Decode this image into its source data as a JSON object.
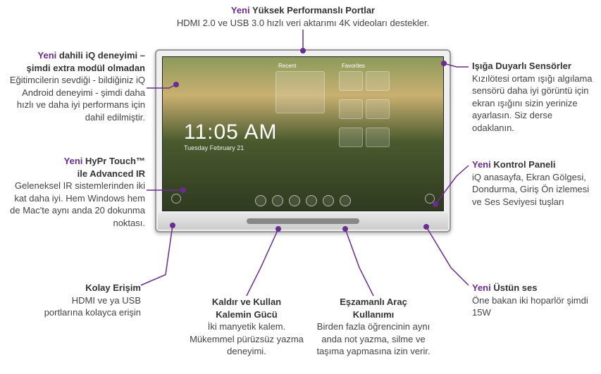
{
  "top": {
    "new": "Yeni",
    "title": " Yüksek Performanslı Portlar",
    "desc": "HDMI 2.0 ve USB 3.0 hızlı veri aktarımı 4K videoları destekler."
  },
  "left1": {
    "new": "Yeni",
    "title_a": " dahili iQ deneyimi –",
    "title_b": "şimdi extra modül olmadan",
    "desc": "Eğitimcilerin sevdiği - bildiğiniz iQ Android deneyimi  - şimdi daha hızlı ve daha iyi performans için dahil edilmiştir."
  },
  "left2": {
    "new": "Yeni",
    "title_a": " HyPr Touch™",
    "title_b": "ile Advanced IR",
    "desc": "Geleneksel IR sistemlerinden iki kat daha iyi. Hem Windows hem de Mac'te aynı anda 20 dokunma noktası."
  },
  "left3": {
    "title": "Kolay Erişim",
    "desc": "HDMI ve ya USB portlarına kolayca erişin"
  },
  "bottom1": {
    "title_a": "Kaldır ve Kullan",
    "title_b": "Kalemin Gücü",
    "desc": "İki manyetik kalem. Mükemmel pürüzsüz yazma deneyimi."
  },
  "bottom2": {
    "title_a": "Eşzamanlı Araç",
    "title_b": "Kullanımı",
    "desc": "Birden fazla öğrencinin aynı anda not yazma, silme ve taşıma yapmasına izin verir."
  },
  "right1": {
    "title": "Işığa Duyarlı Sensörler",
    "desc": "Kızılötesi ortam ışığı algılama sensörü daha iyi görüntü için ekran ışığını sizin yerinize ayarlasın. Siz derse odaklanın."
  },
  "right2": {
    "new": "Yeni",
    "title": " Kontrol Paneli",
    "desc": "iQ anasayfa, Ekran Gölgesi, Dondurma, Giriş Ön izlemesi ve Ses Seviyesi tuşları"
  },
  "right3": {
    "new": "Yeni",
    "title": " Üstün ses",
    "desc": "Öne bakan iki hoparlör şimdi 15W"
  },
  "screen": {
    "time": "11:05 AM",
    "date": "Tuesday February 21",
    "recent_label": "Recent",
    "fav_label": "Favorites"
  }
}
